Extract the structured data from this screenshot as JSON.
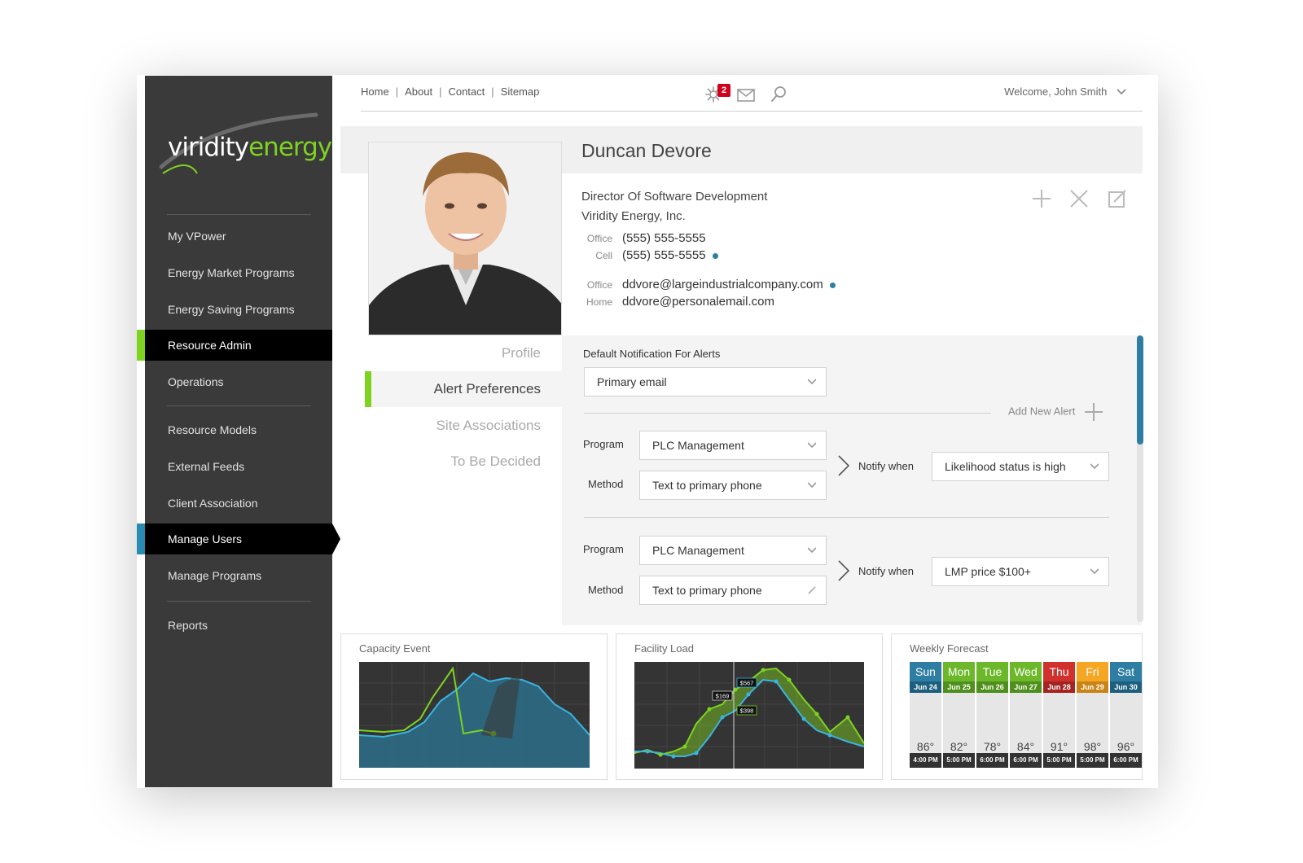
{
  "brand": {
    "logo_part1": "viridity",
    "logo_part2": "energy",
    "accent": "#7ed321",
    "blue": "#2a8bb5"
  },
  "sidebar": {
    "items": [
      {
        "label": "My VPower"
      },
      {
        "label": "Energy Market Programs"
      },
      {
        "label": "Energy Saving Programs"
      },
      {
        "label": "Resource Admin",
        "active": true,
        "marker": "#7ed321"
      },
      {
        "label": "Operations"
      },
      {
        "label": "Resource Models"
      },
      {
        "label": "External Feeds"
      },
      {
        "label": "Client Association"
      },
      {
        "label": "Manage Users",
        "active": true,
        "marker": "#2a8bb5"
      },
      {
        "label": "Manage Programs"
      },
      {
        "label": "Reports"
      }
    ]
  },
  "topbar": {
    "links": [
      "Home",
      "About",
      "Contact",
      "Sitemap"
    ],
    "notification_count": "2",
    "icons": [
      "notification-burst-icon",
      "mail-icon",
      "search-icon"
    ],
    "welcome": "Welcome, John Smith"
  },
  "profile": {
    "name": "Duncan Devore",
    "title": "Director Of Software Development",
    "company": "Viridity Energy, Inc.",
    "phones": [
      {
        "label": "Office",
        "value": "(555) 555-5555",
        "primary": false
      },
      {
        "label": "Cell",
        "value": "(555) 555-5555",
        "primary": true
      }
    ],
    "emails": [
      {
        "label": "Office",
        "value": "ddvore@largeindustrialcompany.com",
        "primary": true
      },
      {
        "label": "Home",
        "value": "ddvore@personalemail.com",
        "primary": false
      }
    ],
    "actions": [
      "add-icon",
      "close-icon",
      "edit-icon"
    ]
  },
  "tabs": [
    {
      "label": "Profile"
    },
    {
      "label": "Alert Preferences",
      "active": true
    },
    {
      "label": "Site Associations"
    },
    {
      "label": "To Be Decided"
    }
  ],
  "alerts": {
    "default_label": "Default Notification For Alerts",
    "default_value": "Primary email",
    "add_new": "Add New Alert",
    "program_label": "Program",
    "method_label": "Method",
    "notify_label": "Notify when",
    "rules": [
      {
        "program": "PLC Management",
        "method": "Text to primary phone",
        "notify": "Likelihood status is high"
      },
      {
        "program": "PLC Management",
        "method": "Text to primary phone",
        "notify": "LMP price $100+"
      }
    ]
  },
  "widgets": {
    "capacity_title": "Capacity Event",
    "facility_title": "Facility Load",
    "facility_tags": [
      "$169",
      "$567",
      "$398"
    ],
    "forecast_title": "Weekly Forecast",
    "forecast": [
      {
        "day": "Sun",
        "date": "Jun 24",
        "temp": "86°",
        "time": "4:00 PM",
        "color": "#2e7ea4"
      },
      {
        "day": "Mon",
        "date": "Jun 25",
        "temp": "82°",
        "time": "5:00 PM",
        "color": "#6cb82a"
      },
      {
        "day": "Tue",
        "date": "Jun 26",
        "temp": "78°",
        "time": "6:00 PM",
        "color": "#6cb82a"
      },
      {
        "day": "Wed",
        "date": "Jun 27",
        "temp": "84°",
        "time": "6:00 PM",
        "color": "#6cb82a"
      },
      {
        "day": "Thu",
        "date": "Jun 28",
        "temp": "91°",
        "time": "5:00 PM",
        "color": "#d0312d"
      },
      {
        "day": "Fri",
        "date": "Jun 29",
        "temp": "98°",
        "time": "5:00 PM",
        "color": "#f5a623"
      },
      {
        "day": "Sat",
        "date": "Jun 30",
        "temp": "96°",
        "time": "6:00 PM",
        "color": "#2e7ea4"
      }
    ]
  }
}
